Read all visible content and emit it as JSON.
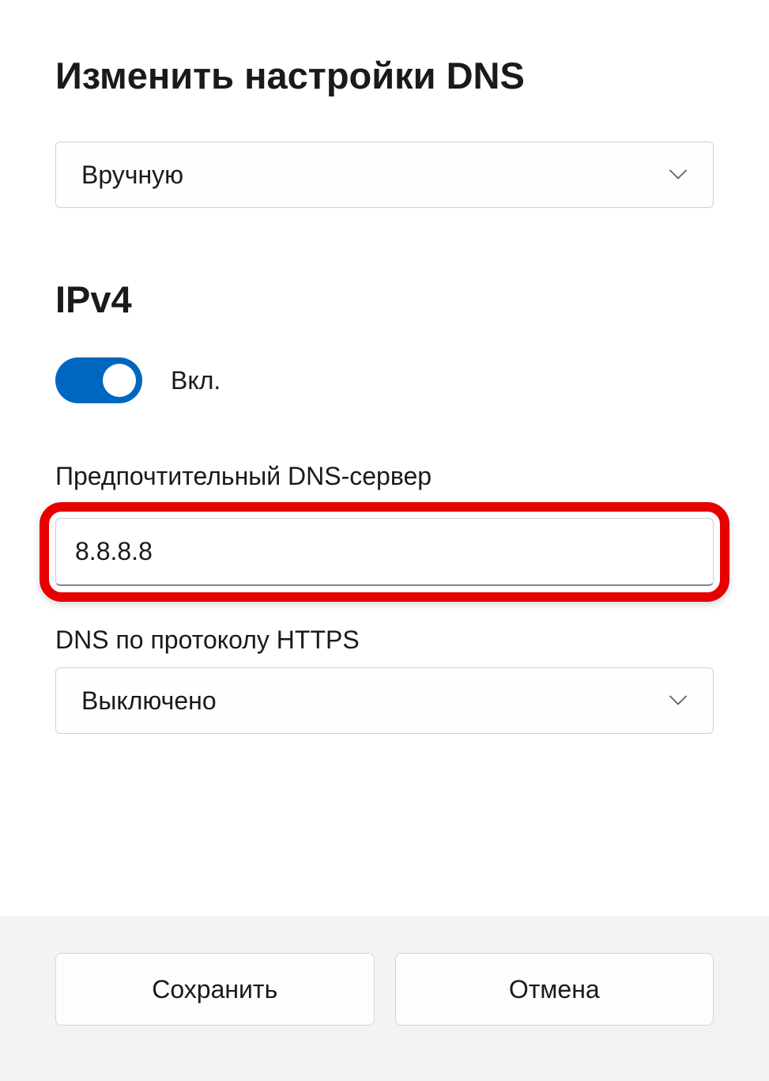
{
  "dialog": {
    "title": "Изменить настройки DNS",
    "mode_dropdown": {
      "value": "Вручную"
    },
    "ipv4": {
      "title": "IPv4",
      "toggle_label": "Вкл.",
      "preferred_dns_label": "Предпочтительный DNS-сервер",
      "preferred_dns_value": "8.8.8.8",
      "doh_label": "DNS по протоколу HTTPS",
      "doh_value": "Выключено"
    },
    "buttons": {
      "save": "Сохранить",
      "cancel": "Отмена"
    }
  }
}
